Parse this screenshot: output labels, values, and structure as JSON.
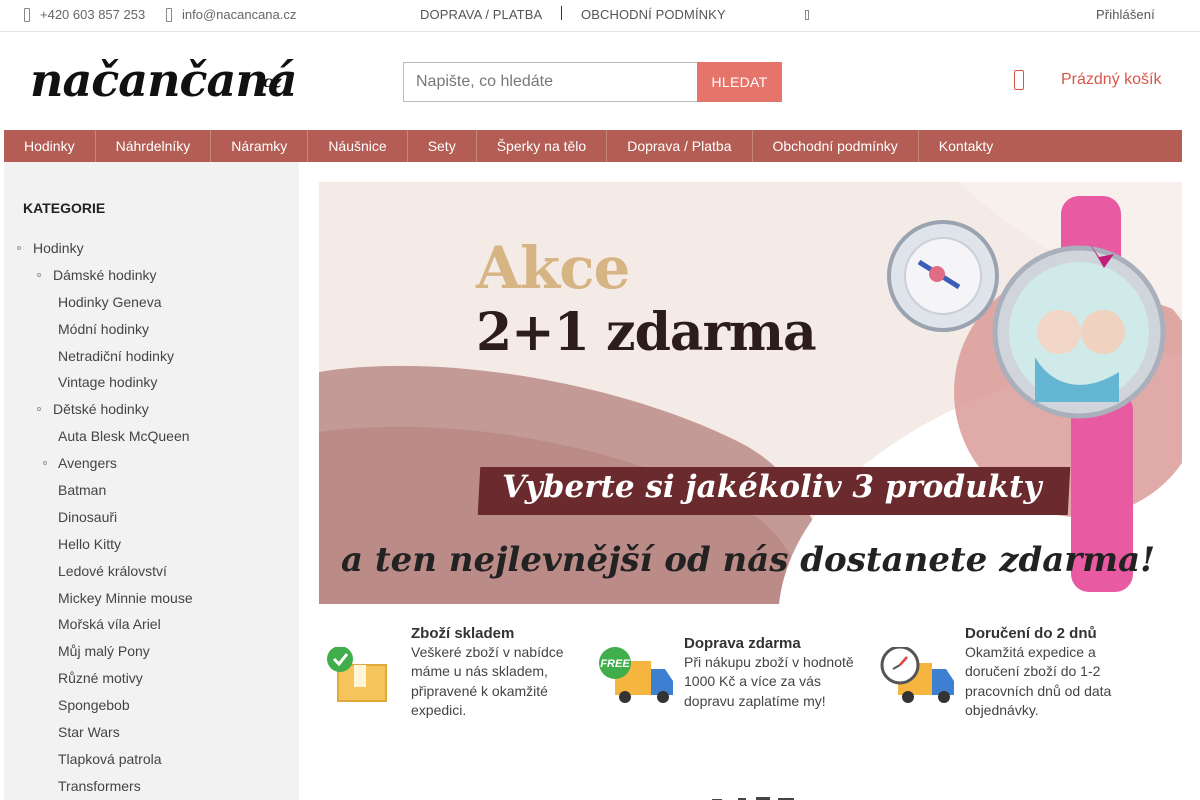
{
  "topbar": {
    "phone": "+420 603 857 253",
    "email": "info@nacancana.cz",
    "links": [
      "DOPRAVA / PLATBA",
      "OBCHODNÍ PODMÍNKY"
    ],
    "login": "Přihlášení"
  },
  "header": {
    "logo_text": "načančaná",
    "logo_suffix": ".cz",
    "search_placeholder": "Napište, co hledáte",
    "search_button": "HLEDAT",
    "cart_label": "Prázdný košík"
  },
  "nav": [
    "Hodinky",
    "Náhrdelníky",
    "Náramky",
    "Náušnice",
    "Sety",
    "Šperky na tělo",
    "Doprava / Platba",
    "Obchodní podmínky",
    "Kontakty"
  ],
  "sidebar": {
    "title": "KATEGORIE",
    "items": [
      {
        "label": "Hodinky",
        "level": 0,
        "bullet": true
      },
      {
        "label": "Dámské hodinky",
        "level": 1,
        "bullet": true
      },
      {
        "label": "Hodinky Geneva",
        "level": 2,
        "bullet": false
      },
      {
        "label": "Módní hodinky",
        "level": 2,
        "bullet": false
      },
      {
        "label": "Netradiční hodinky",
        "level": 2,
        "bullet": false
      },
      {
        "label": "Vintage hodinky",
        "level": 2,
        "bullet": false
      },
      {
        "label": "Dětské hodinky",
        "level": 1,
        "bullet": true
      },
      {
        "label": "Auta Blesk McQueen",
        "level": 2,
        "bullet": false
      },
      {
        "label": "Avengers",
        "level": 2,
        "bullet": true
      },
      {
        "label": "Batman",
        "level": 2,
        "bullet": false
      },
      {
        "label": "Dinosauři",
        "level": 2,
        "bullet": false
      },
      {
        "label": "Hello Kitty",
        "level": 2,
        "bullet": false
      },
      {
        "label": "Ledové království",
        "level": 2,
        "bullet": false
      },
      {
        "label": "Mickey Minnie mouse",
        "level": 2,
        "bullet": false
      },
      {
        "label": "Mořská víla Ariel",
        "level": 2,
        "bullet": false
      },
      {
        "label": "Můj malý Pony",
        "level": 2,
        "bullet": false
      },
      {
        "label": "Různé motivy",
        "level": 2,
        "bullet": false
      },
      {
        "label": "Spongebob",
        "level": 2,
        "bullet": false
      },
      {
        "label": "Star Wars",
        "level": 2,
        "bullet": false
      },
      {
        "label": "Tlapková patrola",
        "level": 2,
        "bullet": false
      },
      {
        "label": "Transformers",
        "level": 2,
        "bullet": false
      }
    ]
  },
  "banner": {
    "headline": "Akce",
    "offer": "2+1 zdarma",
    "ribbon": "Vyberte si jakékoliv 3 produkty",
    "bottom": "a ten nejlevnější od nás dostanete zdarma!"
  },
  "features": [
    {
      "title": "Zboží skladem",
      "text": "Veškeré zboží v nabídce máme u nás skladem, připravené k okamžité expedici.",
      "icon": "box-check-icon"
    },
    {
      "title": "Doprava zdarma",
      "text": "Při nákupu zboží v hodnotě 1000 Kč a více za vás dopravu zaplatíme my!",
      "icon": "free-truck-icon",
      "badge": "FREE"
    },
    {
      "title": "Doručení do 2 dnů",
      "text": "Okamžitá expedice a doručení zboží do 1-2 pracovních dnů od data objednávky.",
      "icon": "clock-truck-icon"
    }
  ],
  "colors": {
    "nav": "#b35d54",
    "accent": "#e5746a",
    "cart": "#d9574a",
    "sidebar": "#f2f2f2"
  }
}
